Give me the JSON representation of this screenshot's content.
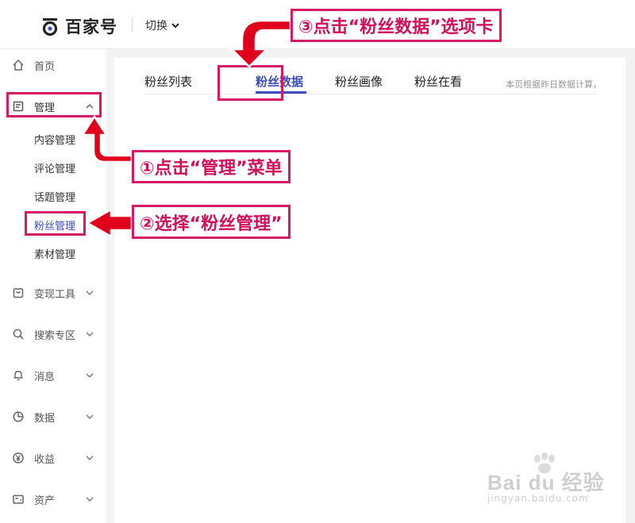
{
  "header": {
    "logo_text": "百家号",
    "switch_label": "切换"
  },
  "sidebar": {
    "items": [
      {
        "label": "首页",
        "icon": "home-icon"
      },
      {
        "label": "管理",
        "icon": "document-icon"
      },
      {
        "label": "变现工具",
        "icon": "bag-icon"
      },
      {
        "label": "搜索专区",
        "icon": "search-icon"
      },
      {
        "label": "消息",
        "icon": "bell-icon"
      },
      {
        "label": "数据",
        "icon": "pie-chart-icon"
      },
      {
        "label": "收益",
        "icon": "yen-coin-icon"
      },
      {
        "label": "资产",
        "icon": "wallet-icon"
      }
    ],
    "sub_items": [
      "内容管理",
      "评论管理",
      "话题管理",
      "粉丝管理",
      "素材管理"
    ],
    "active_sub": "粉丝管理"
  },
  "tabs": {
    "items": [
      "粉丝列表",
      "粉丝数据",
      "粉丝画像",
      "粉丝在看"
    ],
    "active": "粉丝数据",
    "note": "本页根据昨日数据计算，"
  },
  "annotations": {
    "step1": "①点击“管理”菜单",
    "step2": "②选择“粉丝管理”",
    "step3": "③点击“粉丝数据”选项卡"
  },
  "watermark": {
    "brand": "Bai du 经验",
    "url": "jingyan.baidu.com"
  },
  "colors": {
    "accent": "#3a4cc0",
    "annotation": "#d81a66",
    "arrow": "#e0001b"
  }
}
